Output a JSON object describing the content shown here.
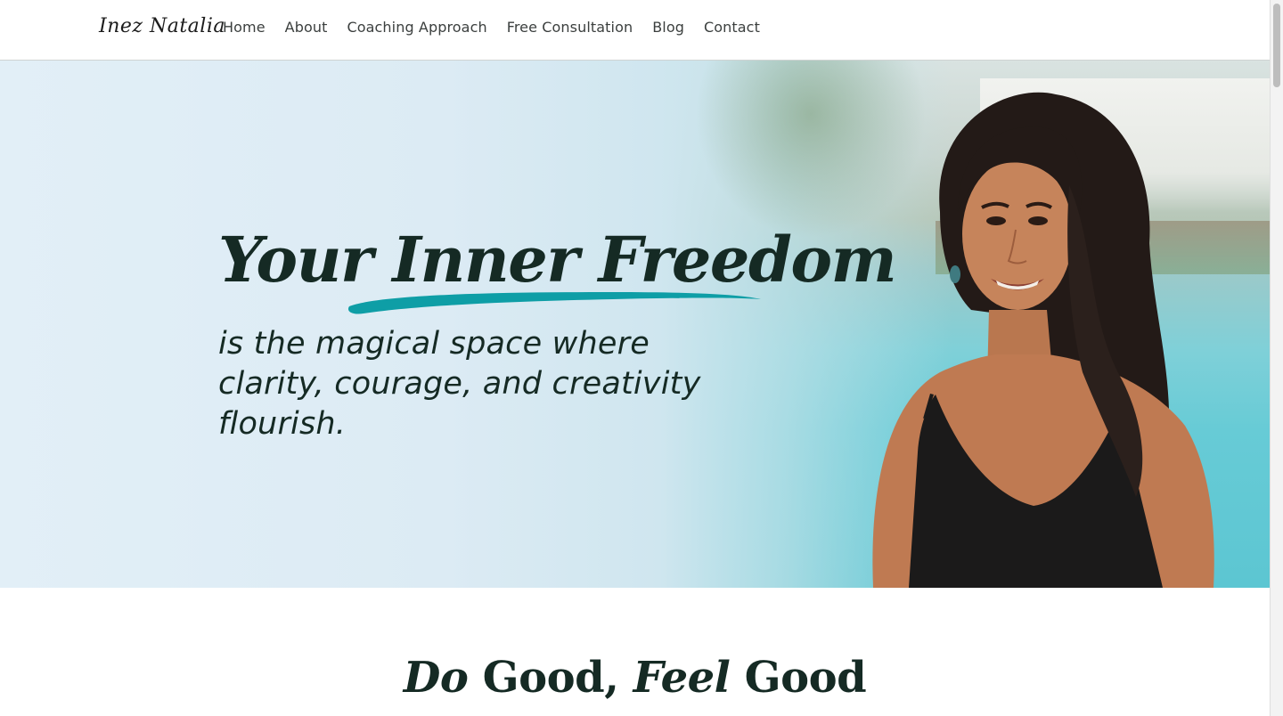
{
  "nav": {
    "logo": "Inez Natalia",
    "links": [
      "Home",
      "About",
      "Coaching Approach",
      "Free Consultation",
      "Blog",
      "Contact"
    ]
  },
  "hero": {
    "headline": "Your Inner Freedom",
    "subhead": "is the magical space where clarity, courage, and creativity flourish.",
    "accent_color": "#0e9ea6",
    "text_color": "#152a24"
  },
  "section": {
    "title_word_1": "Do",
    "title_word_2": " Good, ",
    "title_word_3": "Feel",
    "title_word_4": " Good"
  }
}
